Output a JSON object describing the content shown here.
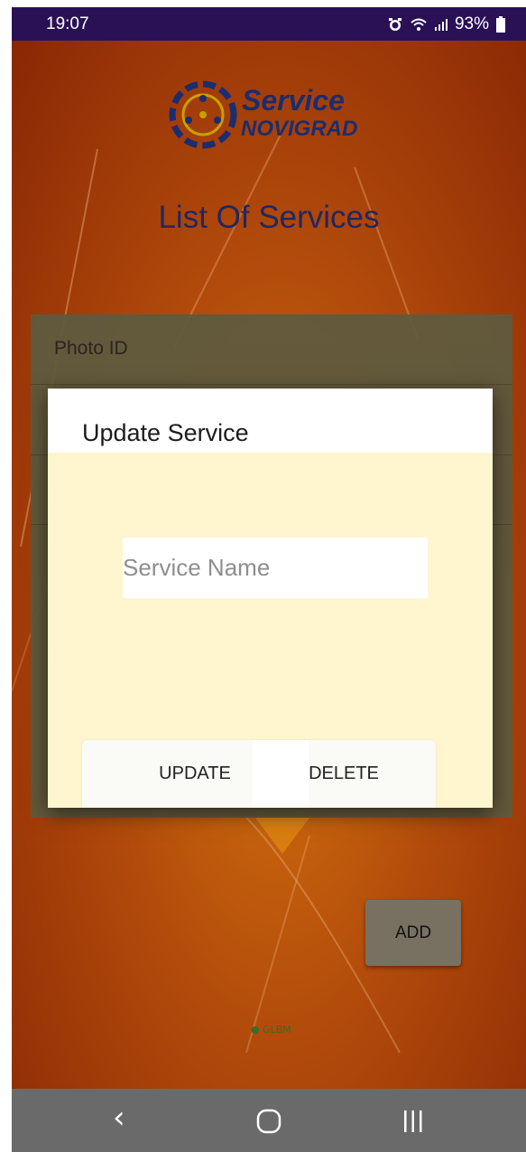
{
  "status_bar": {
    "time": "19:07",
    "battery": "93%",
    "icons": [
      "alarm-icon",
      "wifi-icon",
      "signal-icon",
      "battery-icon"
    ]
  },
  "app": {
    "logo": {
      "line1": "Service",
      "line2": "NOVIGRAD"
    },
    "title": "List Of Services",
    "list": {
      "header": "Photo ID"
    },
    "add_button": "ADD",
    "watermark": "GLBM"
  },
  "dialog": {
    "title": "Update Service",
    "service_name_placeholder": "Service Name",
    "service_name_value": "",
    "update_button": "UPDATE",
    "delete_button": "DELETE"
  },
  "nav_bar": {
    "back": "back-icon",
    "home": "home-icon",
    "recents": "recents-icon"
  },
  "colors": {
    "background_orange": "#c2600c",
    "dialog_bg": "#fff6d0",
    "title_blue": "#22275e",
    "status_bar": "#2a1155",
    "nav_bar": "#6a6a6a"
  }
}
